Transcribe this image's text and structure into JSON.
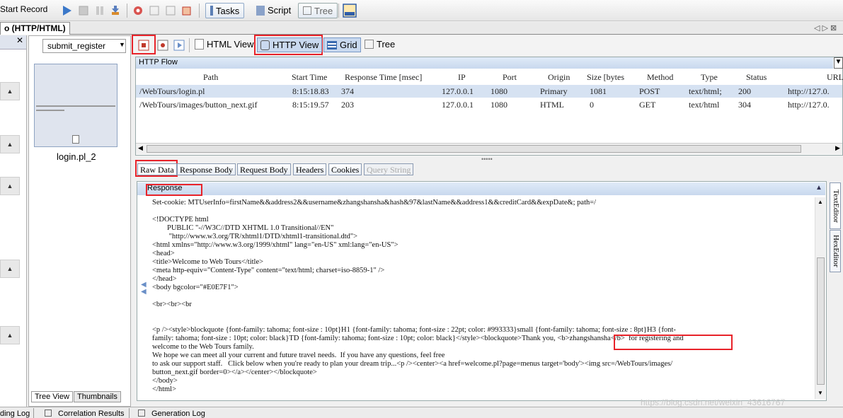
{
  "toolbar": {
    "start_record": "Start Record",
    "tasks": "Tasks",
    "script": "Script",
    "tree": "Tree"
  },
  "doc_tab": "o (HTTP/HTML)",
  "left_panel": {
    "step_selector": "submit_register",
    "thumbnail_caption": "login.pl_2",
    "tab_tree_view": "Tree View",
    "tab_thumbnails": "Thumbnails"
  },
  "view_bar": {
    "html_view": "HTML View",
    "http_view": "HTTP View",
    "grid": "Grid",
    "tree": "Tree"
  },
  "http_flow": {
    "title": "HTTP Flow",
    "columns": [
      "Path",
      "Start Time",
      "Response Time [msec]",
      "IP",
      "Port",
      "Origin",
      "Size [bytes",
      "Method",
      "Type",
      "Status",
      "URL"
    ],
    "rows": [
      [
        "/WebTours/login.pl",
        "8:15:18.83",
        "374",
        "127.0.0.1",
        "1080",
        "Primary",
        "1081",
        "POST",
        "text/html;",
        "200",
        "http://127.0."
      ],
      [
        "/WebTours/images/button_next.gif",
        "8:15:19.57",
        "203",
        "127.0.0.1",
        "1080",
        "HTML",
        "0",
        "GET",
        "text/html",
        "304",
        "http://127.0."
      ]
    ]
  },
  "sub_tabs": [
    "Raw Data",
    "Response Body",
    "Request Body",
    "Headers",
    "Cookies",
    "Query String"
  ],
  "response": {
    "title": "Response",
    "lines": [
      "Set-cookie: MTUserInfo=firstName&&address2&&username&zhangshansha&hash&97&lastName&&address1&&creditCard&&expDate&; path=/",
      "",
      "<!DOCTYPE html",
      "        PUBLIC \"-//W3C//DTD XHTML 1.0 Transitional//EN\"",
      "         \"http://www.w3.org/TR/xhtml1/DTD/xhtml1-transitional.dtd\">",
      "<html xmlns=\"http://www.w3.org/1999/xhtml\" lang=\"en-US\" xml:lang=\"en-US\">",
      "<head>",
      "<title>Welcome to Web Tours</title>",
      "<meta http-equiv=\"Content-Type\" content=\"text/html; charset=iso-8859-1\" />",
      "</head>",
      "<body bgcolor=\"#E0E7F1\">",
      "",
      "<br><br><br",
      "",
      "",
      "<p /><style>blockquote {font-family: tahoma; font-size : 10pt}H1 {font-family: tahoma; font-size : 22pt; color: #993333}small {font-family: tahoma; font-size : 8pt}H3 {font-",
      "family: tahoma; font-size : 10pt; color: black}TD {font-family: tahoma; font-size : 10pt; color: black}</style><blockquote>Thank you, <b>zhangshansha</b>  for registering and",
      "welcome to the Web Tours family.",
      "We hope we can meet all your current and future travel needs.  If you have any questions, feel free",
      "to ask our support staff.   Click below when you're ready to plan your dream trip...<p /><center><a href=welcome.pl?page=menus target='body'><img src=/WebTours/images/",
      "button_next.gif border=0></a></center></blockquote>",
      "</body>",
      "</html>"
    ]
  },
  "right_tabs": [
    "TextEditor",
    "HexEditor"
  ],
  "bottom_tabs": [
    "ding Log",
    "Correlation Results",
    "Generation Log"
  ],
  "watermark": "https://blog.csdn.net/weixin_43616767"
}
